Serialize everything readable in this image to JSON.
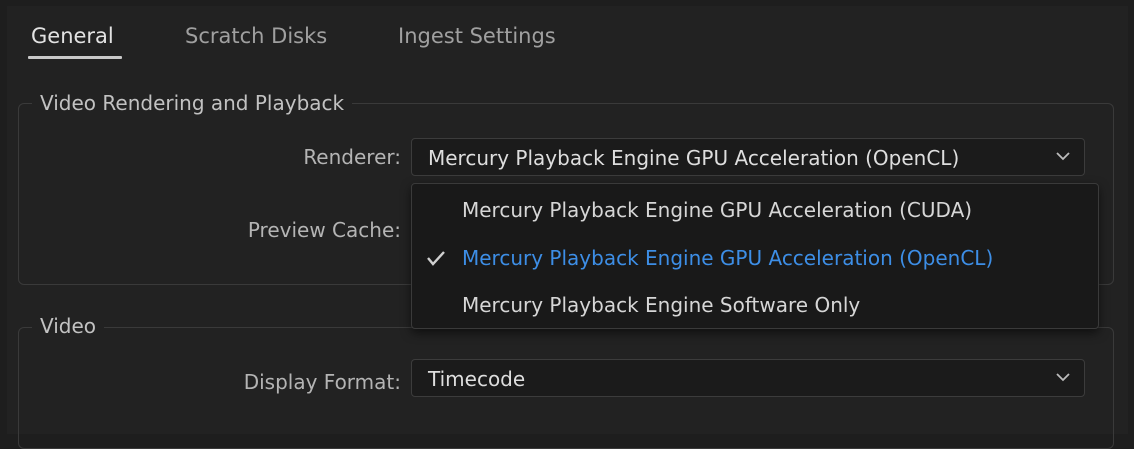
{
  "tabs": [
    {
      "label": "General",
      "active": true
    },
    {
      "label": "Scratch Disks",
      "active": false
    },
    {
      "label": "Ingest Settings",
      "active": false
    }
  ],
  "groups": {
    "video_rendering": {
      "title": "Video Rendering and Playback",
      "renderer": {
        "label": "Renderer:",
        "value": "Mercury Playback Engine GPU Acceleration (OpenCL)",
        "options": [
          {
            "label": "Mercury Playback Engine GPU Acceleration (CUDA)",
            "selected": false
          },
          {
            "label": "Mercury Playback Engine GPU Acceleration (OpenCL)",
            "selected": true
          },
          {
            "label": "Mercury Playback Engine Software Only",
            "selected": false
          }
        ]
      },
      "preview_cache": {
        "label": "Preview Cache:"
      }
    },
    "video": {
      "title": "Video",
      "display_format": {
        "label": "Display Format:",
        "value": "Timecode"
      }
    }
  },
  "colors": {
    "background": "#222222",
    "selected_item": "#3d8ee6",
    "text_primary": "#dedede",
    "text_secondary": "#a0a0a0"
  },
  "icons": {
    "dropdown": "chevron-down-icon",
    "selected": "checkmark-icon"
  }
}
